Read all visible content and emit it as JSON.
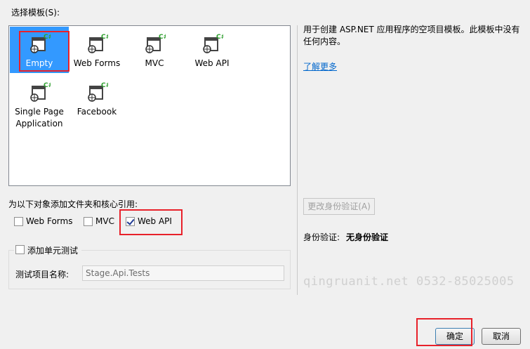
{
  "select_template_label": "选择模板(S):",
  "templates": [
    {
      "label": "Empty",
      "icon": "empty-project-icon"
    },
    {
      "label": "Web Forms",
      "icon": "web-forms-project-icon"
    },
    {
      "label": "MVC",
      "icon": "mvc-project-icon"
    },
    {
      "label": "Web API",
      "icon": "web-api-project-icon"
    },
    {
      "label": "Single Page",
      "label2": "Application",
      "icon": "spa-project-icon"
    },
    {
      "label": "Facebook",
      "icon": "facebook-project-icon"
    }
  ],
  "description": {
    "line1": "用于创建 ASP.NET 应用程序的空项目模板。此模板中没有",
    "line2": "任何内容。",
    "learn_more": "了解更多"
  },
  "add_folders_label": "为以下对象添加文件夹和核心引用:",
  "folder_options": [
    {
      "label": "Web Forms",
      "checked": false
    },
    {
      "label": "MVC",
      "checked": false
    },
    {
      "label": "Web API",
      "checked": true
    }
  ],
  "unit_test": {
    "label": "添加单元测试",
    "checked": false,
    "project_name_label": "测试项目名称:",
    "project_name_value": "Stage.Api.Tests"
  },
  "auth": {
    "change_button": "更改身份验证(A)",
    "label": "身份验证:",
    "value": "无身份验证"
  },
  "watermark": "qingruanit.net 0532-85025005",
  "buttons": {
    "ok": "确定",
    "cancel": "取消"
  },
  "colors": {
    "selection": "#3399ff",
    "highlight_box": "#e8212a",
    "link": "#0066cc"
  }
}
